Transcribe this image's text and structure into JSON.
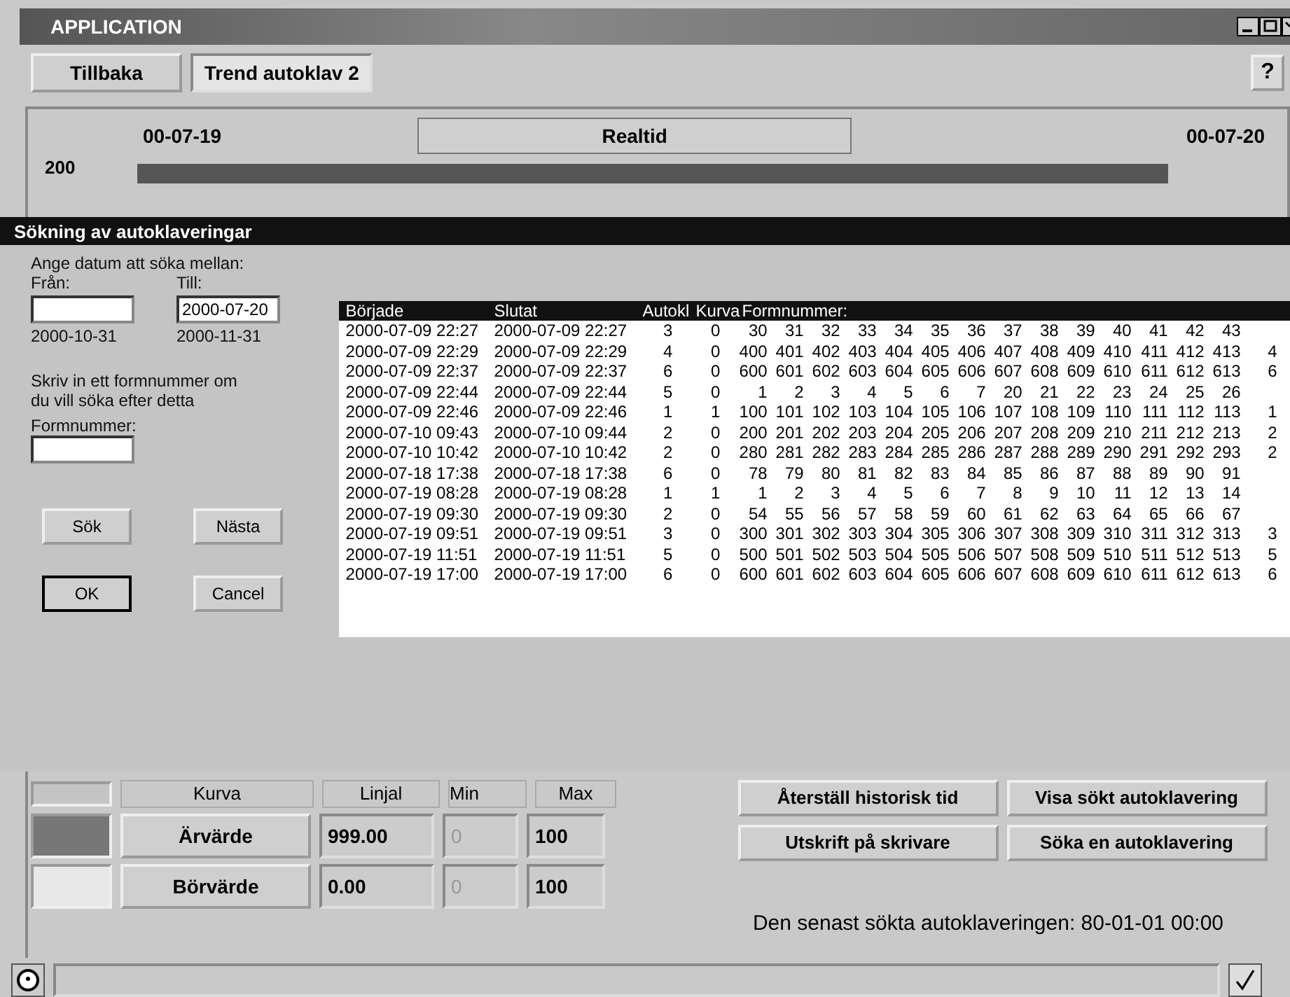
{
  "window": {
    "title": "APPLICATION"
  },
  "nav_buttons": [
    {
      "label": "Tillbaka",
      "selected": false
    },
    {
      "label": "Trend autoklav 2",
      "selected": true
    }
  ],
  "help_button": "?",
  "trend": {
    "start_date": "00-07-19",
    "realtime_button": "Realtid",
    "end_date": "00-07-20",
    "y_max": "200"
  },
  "dialog": {
    "title": "Sökning av autoklaveringar",
    "prompt": "Ange datum att söka mellan:",
    "from_label": "Från:",
    "to_label": "Till:",
    "to_value": "2000-07-20",
    "from_hint": "2000-10-31",
    "to_hint": "2000-11-31",
    "form_prompt": "Skriv in ett formnummer om\ndu vill söka efter detta",
    "form_label": "Formnummer:",
    "buttons": [
      {
        "label": "Sök",
        "default": false
      },
      {
        "label": "Nästa",
        "default": false
      },
      {
        "label": "OK",
        "default": true
      },
      {
        "label": "Cancel",
        "default": false
      }
    ],
    "table": {
      "columns": [
        "Började",
        "Slutat",
        "Autokl",
        "Kurva",
        "Formnummer:"
      ],
      "rows": [
        {
          "started": "2000-07-09 22:27",
          "ended": "2000-07-09 22:27",
          "autokl": "3",
          "kurva": "0",
          "formnummer": [
            "30",
            "31",
            "32",
            "33",
            "34",
            "35",
            "36",
            "37",
            "38",
            "39",
            "40",
            "41",
            "42",
            "43"
          ]
        },
        {
          "started": "2000-07-09 22:29",
          "ended": "2000-07-09 22:29",
          "autokl": "4",
          "kurva": "0",
          "formnummer": [
            "400",
            "401",
            "402",
            "403",
            "404",
            "405",
            "406",
            "407",
            "408",
            "409",
            "410",
            "411",
            "412",
            "413",
            "4"
          ]
        },
        {
          "started": "2000-07-09 22:37",
          "ended": "2000-07-09 22:37",
          "autokl": "6",
          "kurva": "0",
          "formnummer": [
            "600",
            "601",
            "602",
            "603",
            "604",
            "605",
            "606",
            "607",
            "608",
            "609",
            "610",
            "611",
            "612",
            "613",
            "6"
          ]
        },
        {
          "started": "2000-07-09 22:44",
          "ended": "2000-07-09 22:44",
          "autokl": "5",
          "kurva": "0",
          "formnummer": [
            "1",
            "2",
            "3",
            "4",
            "5",
            "6",
            "7",
            "20",
            "21",
            "22",
            "23",
            "24",
            "25",
            "26"
          ]
        },
        {
          "started": "2000-07-09 22:46",
          "ended": "2000-07-09 22:46",
          "autokl": "1",
          "kurva": "1",
          "formnummer": [
            "100",
            "101",
            "102",
            "103",
            "104",
            "105",
            "106",
            "107",
            "108",
            "109",
            "110",
            "111",
            "112",
            "113",
            "1"
          ]
        },
        {
          "started": "2000-07-10 09:43",
          "ended": "2000-07-10 09:44",
          "autokl": "2",
          "kurva": "0",
          "formnummer": [
            "200",
            "201",
            "202",
            "203",
            "204",
            "205",
            "206",
            "207",
            "208",
            "209",
            "210",
            "211",
            "212",
            "213",
            "2"
          ]
        },
        {
          "started": "2000-07-10 10:42",
          "ended": "2000-07-10 10:42",
          "autokl": "2",
          "kurva": "0",
          "formnummer": [
            "280",
            "281",
            "282",
            "283",
            "284",
            "285",
            "286",
            "287",
            "288",
            "289",
            "290",
            "291",
            "292",
            "293",
            "2"
          ]
        },
        {
          "started": "2000-07-18 17:38",
          "ended": "2000-07-18 17:38",
          "autokl": "6",
          "kurva": "0",
          "formnummer": [
            "78",
            "79",
            "80",
            "81",
            "82",
            "83",
            "84",
            "85",
            "86",
            "87",
            "88",
            "89",
            "90",
            "91"
          ]
        },
        {
          "started": "2000-07-19 08:28",
          "ended": "2000-07-19 08:28",
          "autokl": "1",
          "kurva": "1",
          "formnummer": [
            "1",
            "2",
            "3",
            "4",
            "5",
            "6",
            "7",
            "8",
            "9",
            "10",
            "11",
            "12",
            "13",
            "14"
          ]
        },
        {
          "started": "2000-07-19 09:30",
          "ended": "2000-07-19 09:30",
          "autokl": "2",
          "kurva": "0",
          "formnummer": [
            "54",
            "55",
            "56",
            "57",
            "58",
            "59",
            "60",
            "61",
            "62",
            "63",
            "64",
            "65",
            "66",
            "67"
          ]
        },
        {
          "started": "2000-07-19 09:51",
          "ended": "2000-07-19 09:51",
          "autokl": "3",
          "kurva": "0",
          "formnummer": [
            "300",
            "301",
            "302",
            "303",
            "304",
            "305",
            "306",
            "307",
            "308",
            "309",
            "310",
            "311",
            "312",
            "313",
            "3"
          ]
        },
        {
          "started": "2000-07-19 11:51",
          "ended": "2000-07-19 11:51",
          "autokl": "5",
          "kurva": "0",
          "formnummer": [
            "500",
            "501",
            "502",
            "503",
            "504",
            "505",
            "506",
            "507",
            "508",
            "509",
            "510",
            "511",
            "512",
            "513",
            "5"
          ]
        },
        {
          "started": "2000-07-19 17:00",
          "ended": "2000-07-19 17:00",
          "autokl": "6",
          "kurva": "0",
          "formnummer": [
            "600",
            "601",
            "602",
            "603",
            "604",
            "605",
            "606",
            "607",
            "608",
            "609",
            "610",
            "611",
            "612",
            "613",
            "6"
          ]
        }
      ]
    }
  },
  "curve_table": {
    "columns": [
      "Kurva",
      "Linjal",
      "Min",
      "Max"
    ],
    "rows": [
      {
        "color": "#777777",
        "name": "Ärvärde",
        "linjal": "999.00",
        "min": "0",
        "min_disabled": true,
        "max": "100"
      },
      {
        "color": "#e8e8e8",
        "name": "Börvärde",
        "linjal": "0.00",
        "min": "0",
        "min_disabled": true,
        "max": "100"
      }
    ]
  },
  "actions": [
    "Återställ historisk tid",
    "Visa sökt autoklavering",
    "Utskrift på skrivare",
    "Söka en autoklavering"
  ],
  "last_search": "Den senast sökta autoklaveringen: 80-01-01 00:00"
}
